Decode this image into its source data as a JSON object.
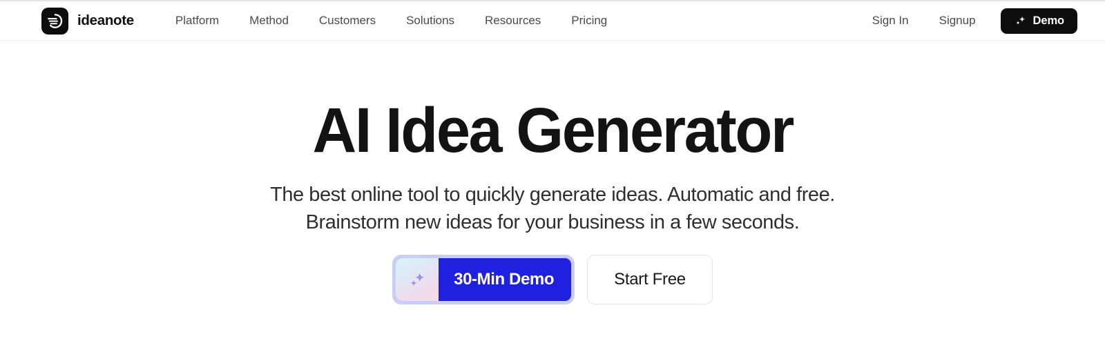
{
  "header": {
    "brand": {
      "logo_icon": "ideanote-motion-mark-icon",
      "name": "ideanote"
    },
    "nav_items": [
      {
        "label": "Platform"
      },
      {
        "label": "Method"
      },
      {
        "label": "Customers"
      },
      {
        "label": "Solutions"
      },
      {
        "label": "Resources"
      },
      {
        "label": "Pricing"
      }
    ],
    "auth": [
      {
        "label": "Sign In"
      },
      {
        "label": "Signup"
      }
    ],
    "demo_button": {
      "label": "Demo",
      "icon": "sparkles-icon",
      "background": "#0d0d0d",
      "text_color": "#ffffff"
    }
  },
  "hero": {
    "title": "AI Idea Generator",
    "subtitle_line1": "The best online tool to quickly generate ideas. Automatic and free.",
    "subtitle_line2": "Brainstorm new ideas for your business in a few seconds.",
    "cta_primary": {
      "label": "30-Min Demo",
      "icon": "sparkles-icon",
      "background": "#2020df",
      "ring_color": "#c9cef6",
      "text_color": "#ffffff"
    },
    "cta_secondary": {
      "label": "Start Free",
      "background": "#ffffff",
      "border_color": "#e3e3e6",
      "text_color": "#1a1a1d"
    }
  },
  "theme": {
    "page_background": "#ffffff",
    "header_border": "#ececed",
    "text_primary": "#131316",
    "text_muted": "#4a4a4f",
    "accent_blue": "#2020df"
  }
}
